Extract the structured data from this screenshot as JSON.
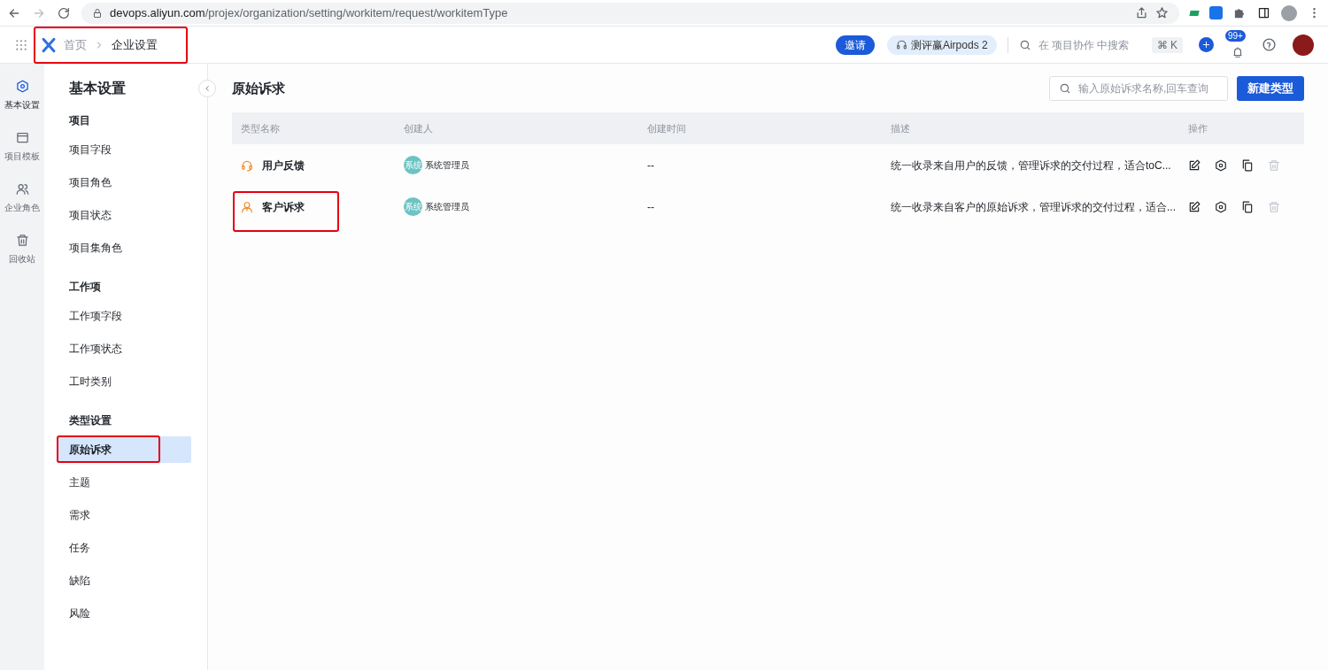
{
  "browser": {
    "url_host": "devops.aliyun.com",
    "url_path": "/projex/organization/setting/workitem/request/workitemType"
  },
  "header": {
    "breadcrumb": [
      "首页",
      "企业设置"
    ],
    "breadcrumb_highlighted": true,
    "invite": "邀请",
    "promo": "测评赢Airpods 2",
    "search_placeholder": "在 项目协作 中搜索",
    "shortcut": "⌘ K",
    "notifications": "99+"
  },
  "rail": [
    {
      "label": "基本设置",
      "kind": "hexagon",
      "selected": true
    },
    {
      "label": "项目模板",
      "kind": "template",
      "selected": false
    },
    {
      "label": "企业角色",
      "kind": "users",
      "selected": false
    },
    {
      "label": "回收站",
      "kind": "trash",
      "selected": false
    }
  ],
  "sidebar": {
    "title": "基本设置",
    "groups": [
      {
        "title": "项目",
        "items": [
          {
            "label": "项目字段",
            "selected": false,
            "highlighted": false
          },
          {
            "label": "项目角色",
            "selected": false,
            "highlighted": false
          },
          {
            "label": "项目状态",
            "selected": false,
            "highlighted": false
          },
          {
            "label": "项目集角色",
            "selected": false,
            "highlighted": false
          }
        ]
      },
      {
        "title": "工作项",
        "items": [
          {
            "label": "工作项字段",
            "selected": false,
            "highlighted": false
          },
          {
            "label": "工作项状态",
            "selected": false,
            "highlighted": false
          },
          {
            "label": "工时类别",
            "selected": false,
            "highlighted": false
          }
        ]
      },
      {
        "title": "类型设置",
        "items": [
          {
            "label": "原始诉求",
            "selected": true,
            "highlighted": true
          },
          {
            "label": "主题",
            "selected": false,
            "highlighted": false
          },
          {
            "label": "需求",
            "selected": false,
            "highlighted": false
          },
          {
            "label": "任务",
            "selected": false,
            "highlighted": false
          },
          {
            "label": "缺陷",
            "selected": false,
            "highlighted": false
          },
          {
            "label": "风险",
            "selected": false,
            "highlighted": false
          }
        ]
      }
    ]
  },
  "main": {
    "title": "原始诉求",
    "search_placeholder": "输入原始诉求名称,回车查询",
    "new_button": "新建类型",
    "table": {
      "columns": [
        "类型名称",
        "创建人",
        "创建时间",
        "描述",
        "操作"
      ],
      "rows": [
        {
          "name": "用户反馈",
          "kind": "headset",
          "highlighted": false,
          "creator_avatar": "系统",
          "creator": "系统管理员",
          "created": "--",
          "description": "统一收录来自用户的反馈，管理诉求的交付过程，适合toC...",
          "delete_disabled": true
        },
        {
          "name": "客户诉求",
          "kind": "person",
          "highlighted": true,
          "creator_avatar": "系统",
          "creator": "系统管理员",
          "created": "--",
          "description": "统一收录来自客户的原始诉求，管理诉求的交付过程，适合...",
          "delete_disabled": true
        }
      ]
    }
  }
}
